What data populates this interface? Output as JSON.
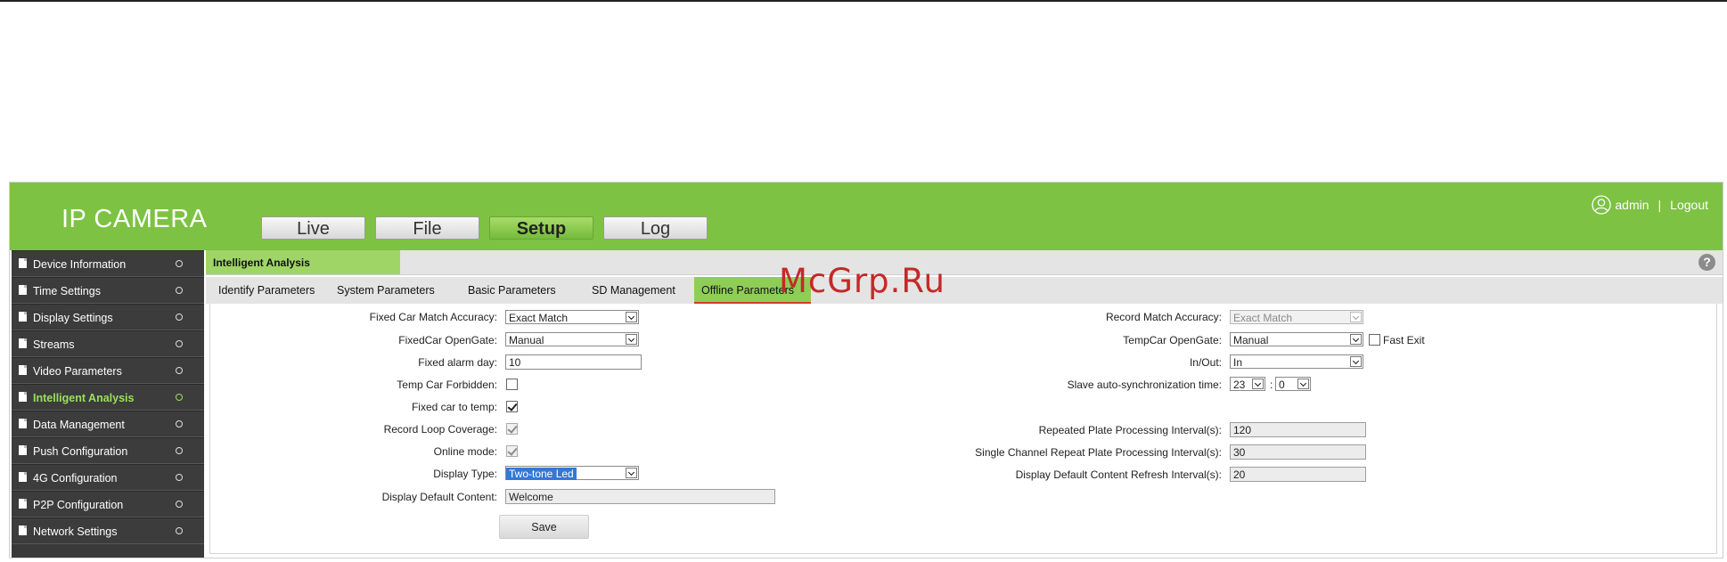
{
  "watermark": "McGrp.Ru",
  "header": {
    "logo": "IP CAMERA",
    "nav": [
      "Live",
      "File",
      "Setup",
      "Log"
    ],
    "active_nav": "Setup",
    "user": "admin",
    "separator": "|",
    "logout": "Logout",
    "user_icon": "user-circle-icon",
    "brand_color": "#7dc242"
  },
  "sidebar": {
    "items": [
      "Device Information",
      "Time Settings",
      "Display Settings",
      "Streams",
      "Video Parameters",
      "Intelligent Analysis",
      "Data Management",
      "Push Configuration",
      "4G Configuration",
      "P2P Configuration",
      "Network Settings"
    ],
    "active": "Intelligent Analysis"
  },
  "content": {
    "title": "Intelligent Analysis",
    "help": "?",
    "tabs": [
      "Identify Parameters",
      "System Parameters",
      "Basic Parameters",
      "SD Management",
      "Offline Parameters"
    ],
    "active_tab": "Offline Parameters"
  },
  "form": {
    "fixed_car_match_accuracy": {
      "label": "Fixed Car Match Accuracy:",
      "value": "Exact Match"
    },
    "fixedcar_opengate": {
      "label": "FixedCar OpenGate:",
      "value": "Manual"
    },
    "fixed_alarm_day": {
      "label": "Fixed alarm day:",
      "value": "10"
    },
    "temp_car_forbidden": {
      "label": "Temp Car Forbidden:",
      "checked": false
    },
    "fixed_car_to_temp": {
      "label": "Fixed car to temp:",
      "checked": true
    },
    "record_loop_coverage": {
      "label": "Record Loop Coverage:",
      "checked": true,
      "disabled": true
    },
    "online_mode": {
      "label": "Online mode:",
      "checked": true,
      "disabled": true
    },
    "display_type": {
      "label": "Display Type:",
      "value": "Two-tone Led"
    },
    "display_default_content": {
      "label": "Display Default Content:",
      "value": "Welcome"
    },
    "record_match_accuracy": {
      "label": "Record Match Accuracy:",
      "value": "Exact Match",
      "disabled": true
    },
    "tempcar_opengate": {
      "label": "TempCar OpenGate:",
      "value": "Manual"
    },
    "fast_exit": {
      "label": "Fast Exit",
      "checked": false
    },
    "in_out": {
      "label": "In/Out:",
      "value": "In"
    },
    "slave_sync_time": {
      "label": "Slave auto-synchronization time:",
      "hour": "23",
      "minute": "0",
      "colon": ":"
    },
    "repeated_plate_interval": {
      "label": "Repeated Plate Processing Interval(s):",
      "value": "120"
    },
    "single_channel_repeat_interval": {
      "label": "Single Channel Repeat Plate Processing Interval(s):",
      "value": "30"
    },
    "display_refresh_interval": {
      "label": "Display Default Content Refresh Interval(s):",
      "value": "20"
    },
    "save_label": "Save"
  }
}
